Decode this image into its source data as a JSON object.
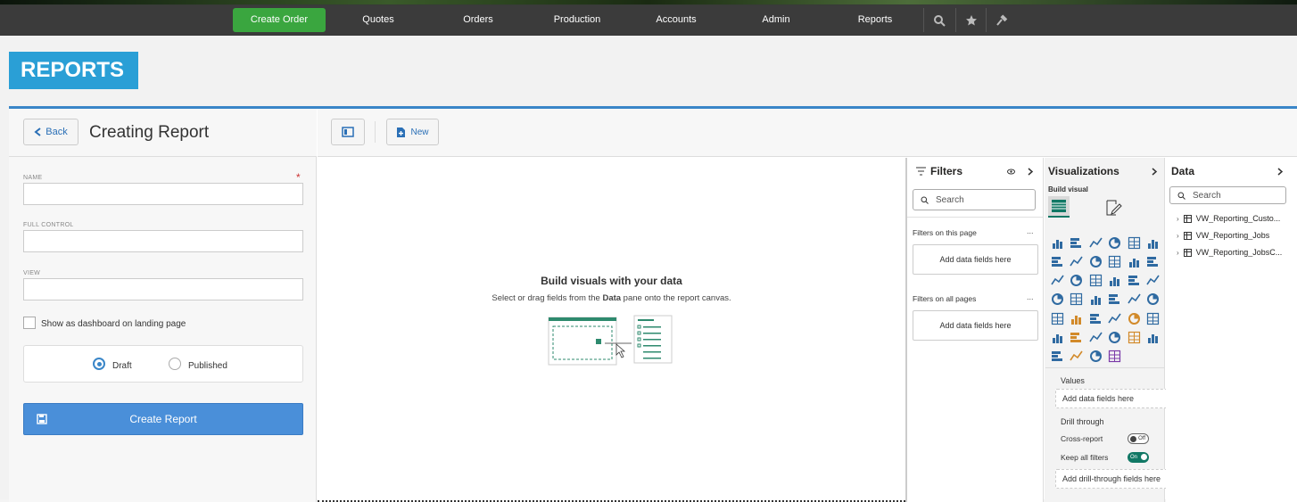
{
  "nav": {
    "items": [
      "Create Order",
      "Quotes",
      "Orders",
      "Production",
      "Accounts",
      "Admin",
      "Reports"
    ],
    "icons": [
      "search-icon",
      "star-icon",
      "hammer-icon"
    ],
    "accent": "#3aa63f"
  },
  "banner": {
    "title": "REPORTS",
    "color": "#2a9fd6"
  },
  "form": {
    "back_label": "Back",
    "page_title": "Creating Report",
    "name_label": "NAME",
    "full_control_label": "FULL CONTROL",
    "view_label": "VIEW",
    "name_value": "",
    "full_control_value": "",
    "view_value": "",
    "dashboard_label": "Show as dashboard on landing page",
    "dashboard_checked": false,
    "status_options": [
      "Draft",
      "Published"
    ],
    "status_selected": "Draft",
    "submit_label": "Create Report",
    "submit_color": "#4a8fd9"
  },
  "toolbar": {
    "new_label": "New"
  },
  "canvas": {
    "title": "Build visuals with your data",
    "sub_before": "Select or drag fields from the ",
    "sub_bold": "Data",
    "sub_after": " pane onto the report canvas."
  },
  "filters": {
    "title": "Filters",
    "search_placeholder": "Search",
    "page_section": "Filters on this page",
    "all_section": "Filters on all pages",
    "add_label": "Add data fields here"
  },
  "visualizations": {
    "title": "Visualizations",
    "build_label": "Build visual",
    "values_label": "Values",
    "values_add": "Add data fields here",
    "drill_label": "Drill through",
    "cross_report_label": "Cross-report",
    "cross_report_state": "Off",
    "keep_filters_label": "Keep all filters",
    "keep_filters_state": "On",
    "drill_add": "Add drill-through fields here"
  },
  "data_pane": {
    "title": "Data",
    "search_placeholder": "Search",
    "tables": [
      "VW_Reporting_Custo...",
      "VW_Reporting_Jobs",
      "VW_Reporting_JobsC..."
    ]
  }
}
